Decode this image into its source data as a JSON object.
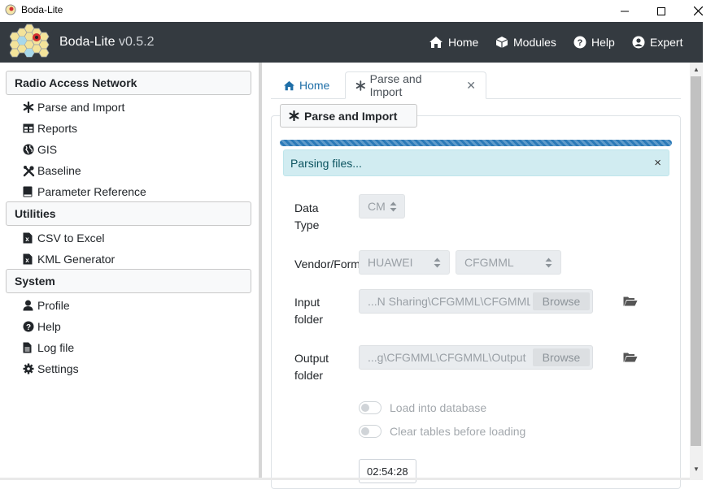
{
  "window": {
    "title": "Boda-Lite",
    "controls": [
      "minimize",
      "maximize",
      "close"
    ]
  },
  "header": {
    "brand": "Boda-Lite",
    "version": "v0.5.2",
    "nav": [
      {
        "label": "Home",
        "icon": "home-icon"
      },
      {
        "label": "Modules",
        "icon": "cube-icon"
      },
      {
        "label": "Help",
        "icon": "question-circle-icon"
      },
      {
        "label": "Expert",
        "icon": "user-circle-icon"
      }
    ]
  },
  "sidebar": {
    "sections": [
      {
        "title": "Radio Access Network",
        "items": [
          {
            "label": "Parse and Import",
            "icon": "asterisk-icon"
          },
          {
            "label": "Reports",
            "icon": "table-icon"
          },
          {
            "label": "GIS",
            "icon": "globe-icon"
          },
          {
            "label": "Baseline",
            "icon": "tools-icon"
          },
          {
            "label": "Parameter Reference",
            "icon": "book-icon"
          }
        ]
      },
      {
        "title": "Utilities",
        "items": [
          {
            "label": "CSV to Excel",
            "icon": "excel-file-icon"
          },
          {
            "label": "KML Generator",
            "icon": "excel-file-icon"
          }
        ]
      },
      {
        "title": "System",
        "items": [
          {
            "label": "Profile",
            "icon": "user-icon"
          },
          {
            "label": "Help",
            "icon": "question-circle-icon"
          },
          {
            "label": "Log file",
            "icon": "file-text-icon"
          },
          {
            "label": "Settings",
            "icon": "gear-icon"
          }
        ]
      }
    ]
  },
  "tabs": [
    {
      "label": "Home",
      "icon": "home-icon",
      "active": false
    },
    {
      "label": "Parse and Import",
      "icon": "asterisk-icon",
      "active": true,
      "closable": true
    }
  ],
  "panel": {
    "title": "Parse and Import",
    "alert": "Parsing files...",
    "form": {
      "data_type_label_1": "Data",
      "data_type_label_2": "Type",
      "data_type_value": "CM",
      "vendor_label": "Vendor/Format",
      "vendor_value": "HUAWEI",
      "format_value": "CFGMML",
      "input_label_1": "Input",
      "input_label_2": "folder",
      "input_value": "...N Sharing\\CFGMML\\CFGMML",
      "output_label_1": "Output",
      "output_label_2": "folder",
      "output_value": "...g\\CFGMML\\CFGMML\\Output",
      "browse_label": "Browse",
      "load_db_label": "Load into database",
      "clear_tables_label": "Clear tables before loading",
      "time_value": "02:54:28"
    }
  },
  "colors": {
    "header_bg": "#343a40",
    "progress": "#2b7ab8",
    "alert_bg": "#d1ecf1",
    "link": "#1f6fa8"
  }
}
